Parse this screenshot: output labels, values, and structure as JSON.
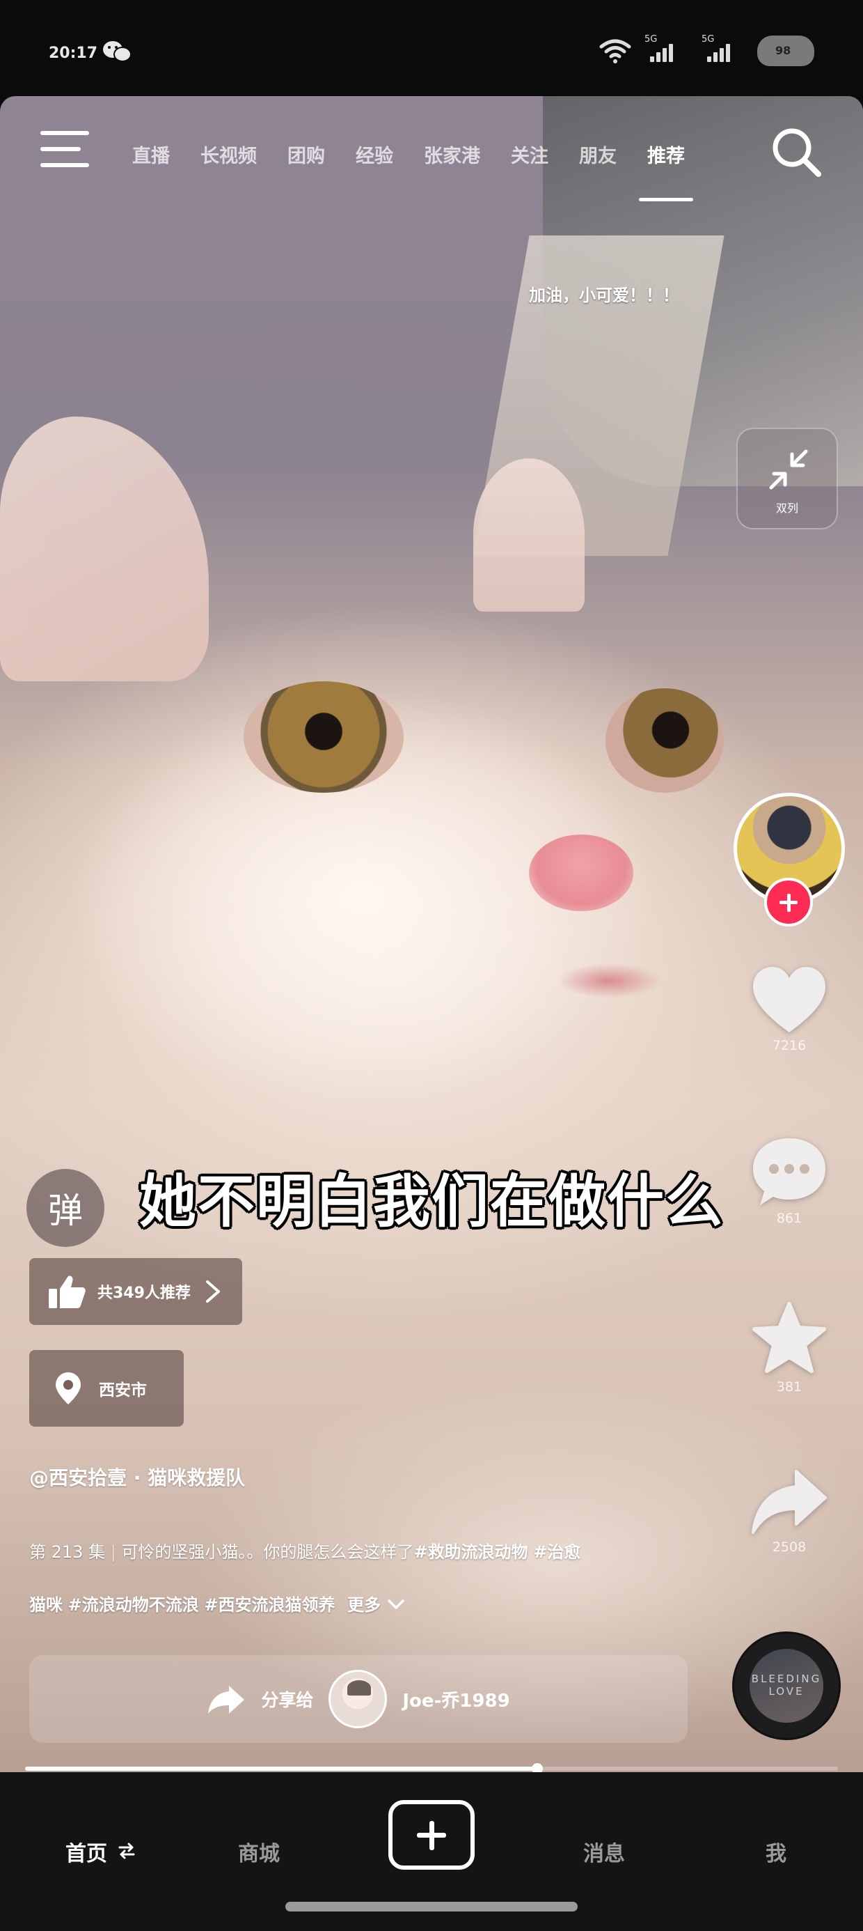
{
  "status_bar": {
    "time": "20:17",
    "signal_tag_1": "5G",
    "signal_tag_2": "5G",
    "battery": "98",
    "icons": [
      "wechat-icon",
      "wifi-icon",
      "signal-icon",
      "battery-icon"
    ]
  },
  "top_nav": {
    "tabs": [
      "直播",
      "长视频",
      "团购",
      "经验",
      "张家港",
      "关注",
      "朋友",
      "推荐"
    ],
    "active_tab": "推荐"
  },
  "danmaku": "加油，小可爱！！！",
  "dual_column": {
    "label": "双列"
  },
  "actions": {
    "likes": "7216",
    "comments": "861",
    "favorites": "381",
    "shares": "2508"
  },
  "music_disc_text": "BLEEDING LOVE",
  "subtitle": "她不明白我们在做什么",
  "danmu_button": "弹",
  "recommend_pill": {
    "label": "共349人推荐"
  },
  "location_pill": {
    "label": "西安市"
  },
  "author": "@西安拾壹 · 猫咪救援队",
  "description": {
    "episode": "第 213 集",
    "text": "可怜的坚强小猫。。你的腿怎么会这样了",
    "tags_line1": [
      "#救助流浪动物",
      "#治愈"
    ],
    "tags_line2": [
      "猫咪",
      "#流浪动物不流浪",
      "#西安流浪猫领养"
    ],
    "more": "更多"
  },
  "share_bar": {
    "label": "分享给",
    "friend_name": "Joe-乔1989"
  },
  "progress": {
    "fraction": 0.63
  },
  "bottom_nav": {
    "home": "首页",
    "mall": "商城",
    "messages": "消息",
    "me": "我"
  },
  "colors": {
    "accent_red": "#fe2c55",
    "bottom_bar": "#141414",
    "active_text": "#ffffff",
    "inactive_text": "#9a9a9a"
  }
}
